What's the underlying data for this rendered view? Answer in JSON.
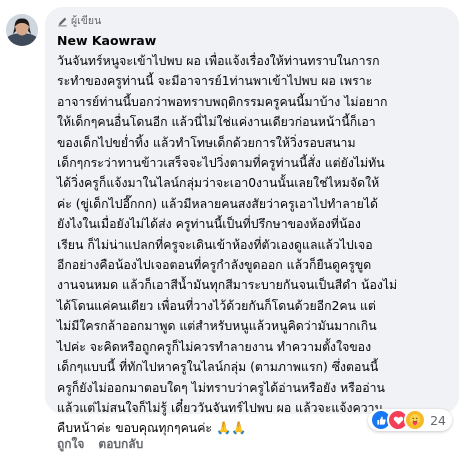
{
  "comment": {
    "badge_label": "ผู้เขียน",
    "author_name": "New Kaowraw",
    "text_lines": [
      "วันจันทร์หนูจะเข้าไปพบ ผอ เพื่อแจ้งเรื่องให้ท่านทราบในการก",
      "ระทำของครูท่านนี้ จะมีอาจารย์1ท่านพาเข้าไปพบ ผอ เพราะ",
      "อาจารย์ท่านนี้บอกว่าพอทราบพฤติกรรมครูคนนี้มาบ้าง ไม่อยาก",
      "ให้เด็กๆคนอื่นโดนอีก แล้วนี่ไม่ใช่แค่งานเดียวก่อนหน้านี้ก็เอา",
      "ของเด็กไปขย่ำทิ้ง แล้วทำโทษเด็กด้วยการให้วิ่งรอบสนาม",
      "เด็กๆกระว่าทานข้าวเสร็จจะไปวิ่งตามที่ครูท่านนี้สั่ง แต่ยังไม่ทัน",
      "ได้วิ่งครูก็แจ้งมาในไลน์กลุ่มว่าจะเอา0งานนั้นเลยใช่ไหมจัดให้",
      "ค่ะ (ขู่เด็กไปอี๊กกก) แล้วมีหลายคนสงสัยว่าครูเอาไปทำลายได้",
      "ยังไงในเมื่อยังไม่ได้ส่ง ครูท่านนี้เป็นที่ปรึกษาของห้องที่น้อง",
      "เรียน ก็ไม่น่าแปลกที่ครูจะเดินเข้าห้องที่ตัวเองดูแลแล้วไปเจอ",
      "อีกอย่างคือน้องไปเจอตอนที่ครูกำลังขูดออก แล้วก็ยืนดูครูขูด",
      "งานจนหมด แล้วก็เอาสีน้ำมันทุกสีมาระบายกันจนเป็นสีดำ น้องไม่",
      "ได้โดนแค่คนเดียว เพื่อนที่วางไว้ด้วยกันก็โดนด้วยอีก2คน แต่",
      "ไม่มีใครกล้าออกมาพูด แต่สำหรับหนูแล้วหนูคิดว่ามันมากเกิน",
      "ไปค่ะ จะคิดหรือถูกครูก็ไม่ควรทำลายงาน ทำความตั้งใจของ",
      "เด็กๆแบบนี้ ที่ทักไปหาครูในไลน์กลุ่ม (ตามภาพแรก) ซึ่งตอนนี้",
      "ครูก็ยังไม่ออกมาตอบใดๆ ไม่ทราบว่าครูได้อ่านหรือยัง หรืออ่าน",
      "แล้วแต่ไม่สนใจก็ไม่รู้ เดี๋ยววันจันทร์ไปพบ ผอ แล้วจะแจ้งความ",
      "คืบหน้าค่ะ ขอบคุณทุกๆคนค่ะ 🙏🙏"
    ],
    "reactions": {
      "icons": [
        "like-icon",
        "love-icon",
        "care-icon"
      ],
      "count": "24"
    },
    "actions": {
      "like_label": "ถูกใจ",
      "reply_label": "ตอบกลับ"
    }
  },
  "colors": {
    "bubble": "#f0f2f5",
    "secondary_text": "#65676b",
    "like_blue": "#1877f2",
    "love_red": "#f33e58",
    "care_yellow": "#f7b928"
  }
}
